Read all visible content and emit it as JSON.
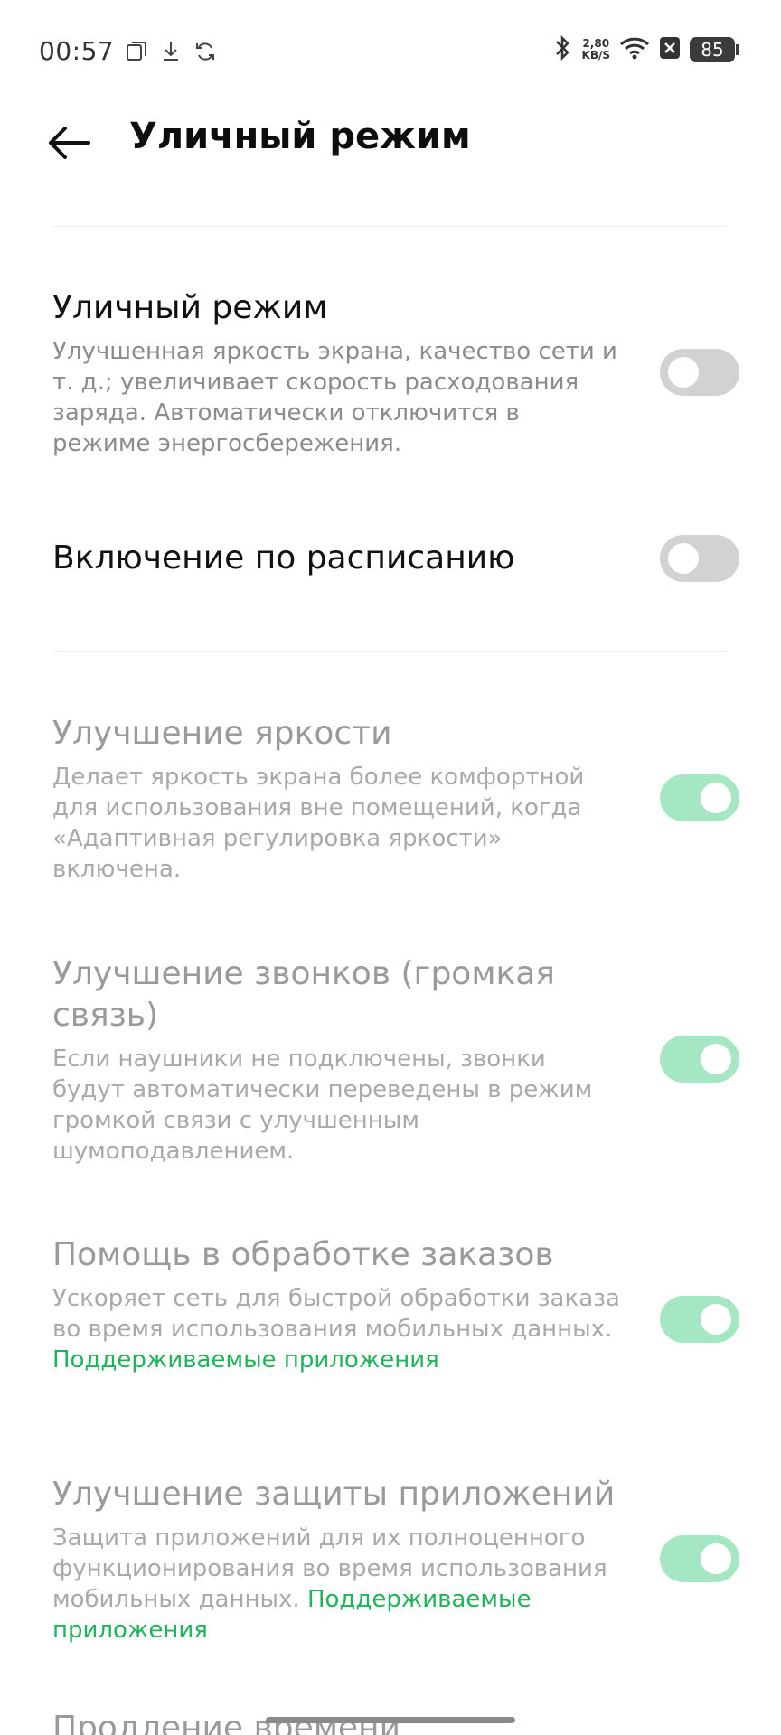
{
  "status_bar": {
    "time": "00:57",
    "speed_value": "2,80",
    "speed_unit": "KB/S",
    "battery": "85",
    "icons": [
      "screen-record-icon",
      "download-icon",
      "sync-icon",
      "bluetooth-icon",
      "wifi-icon",
      "sim-blocked-icon",
      "battery-icon"
    ]
  },
  "header": {
    "title": "Уличный режим"
  },
  "settings": [
    {
      "title": "Уличный режим",
      "description": "Улучшенная яркость экрана, качество сети и т. д.; увеличивает скорость расходования заряда. Автоматически отключится в режиме энергосбережения.",
      "enabled": false,
      "disabled": false
    },
    {
      "title": "Включение по расписанию",
      "enabled": false,
      "disabled": false
    },
    {
      "title": "Улучшение яркости",
      "description": "Делает яркость экрана более комфортной для использования вне помещений, когда «Адаптивная регулировка яркости» включена.",
      "enabled": true,
      "disabled": true
    },
    {
      "title": "Улучшение звонков (громкая связь)",
      "description": "Если наушники не подключены, звонки будут автоматически переведены в режим громкой связи с улучшенным шумоподавлением.",
      "enabled": true,
      "disabled": true
    },
    {
      "title": "Помощь в обработке заказов",
      "description": "Ускоряет сеть для быстрой обработки заказа во время использования мобильных данных.",
      "link": "Поддерживаемые приложения",
      "enabled": true,
      "disabled": true
    },
    {
      "title": "Улучшение защиты приложений",
      "description": "Защита приложений для их полноценного функционирования во время использования мобильных данных.",
      "link": "Поддерживаемые приложения",
      "enabled": true,
      "disabled": true
    },
    {
      "title": "Продление времени"
    }
  ],
  "colors": {
    "toggle_off": "#d2d2d2",
    "toggle_on_disabled": "#a6e7c3",
    "link": "#20b45a"
  }
}
